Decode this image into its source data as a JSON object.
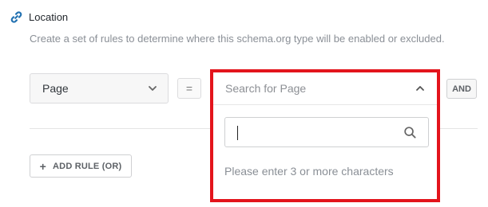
{
  "section": {
    "title": "Location",
    "description": "Create a set of rules to determine where this schema.org type will be enabled or excluded.",
    "icon": "link-icon"
  },
  "rule": {
    "param_select": {
      "value": "Page",
      "icon": "chevron-down-icon"
    },
    "operator": "=",
    "value_dropdown": {
      "placeholder": "Search for Page",
      "toggle_icon": "chevron-up-icon",
      "search": {
        "value": "",
        "placeholder": "",
        "icon": "search-icon"
      },
      "hint": "Please enter 3 or more characters"
    },
    "and_label": "AND"
  },
  "add_rule": {
    "icon": "+",
    "label": "ADD RULE (OR)"
  },
  "colors": {
    "accent_blue": "#2271b1",
    "highlight_red": "#e3141c",
    "muted_text": "#8a8f96",
    "border": "#dcdcde"
  }
}
